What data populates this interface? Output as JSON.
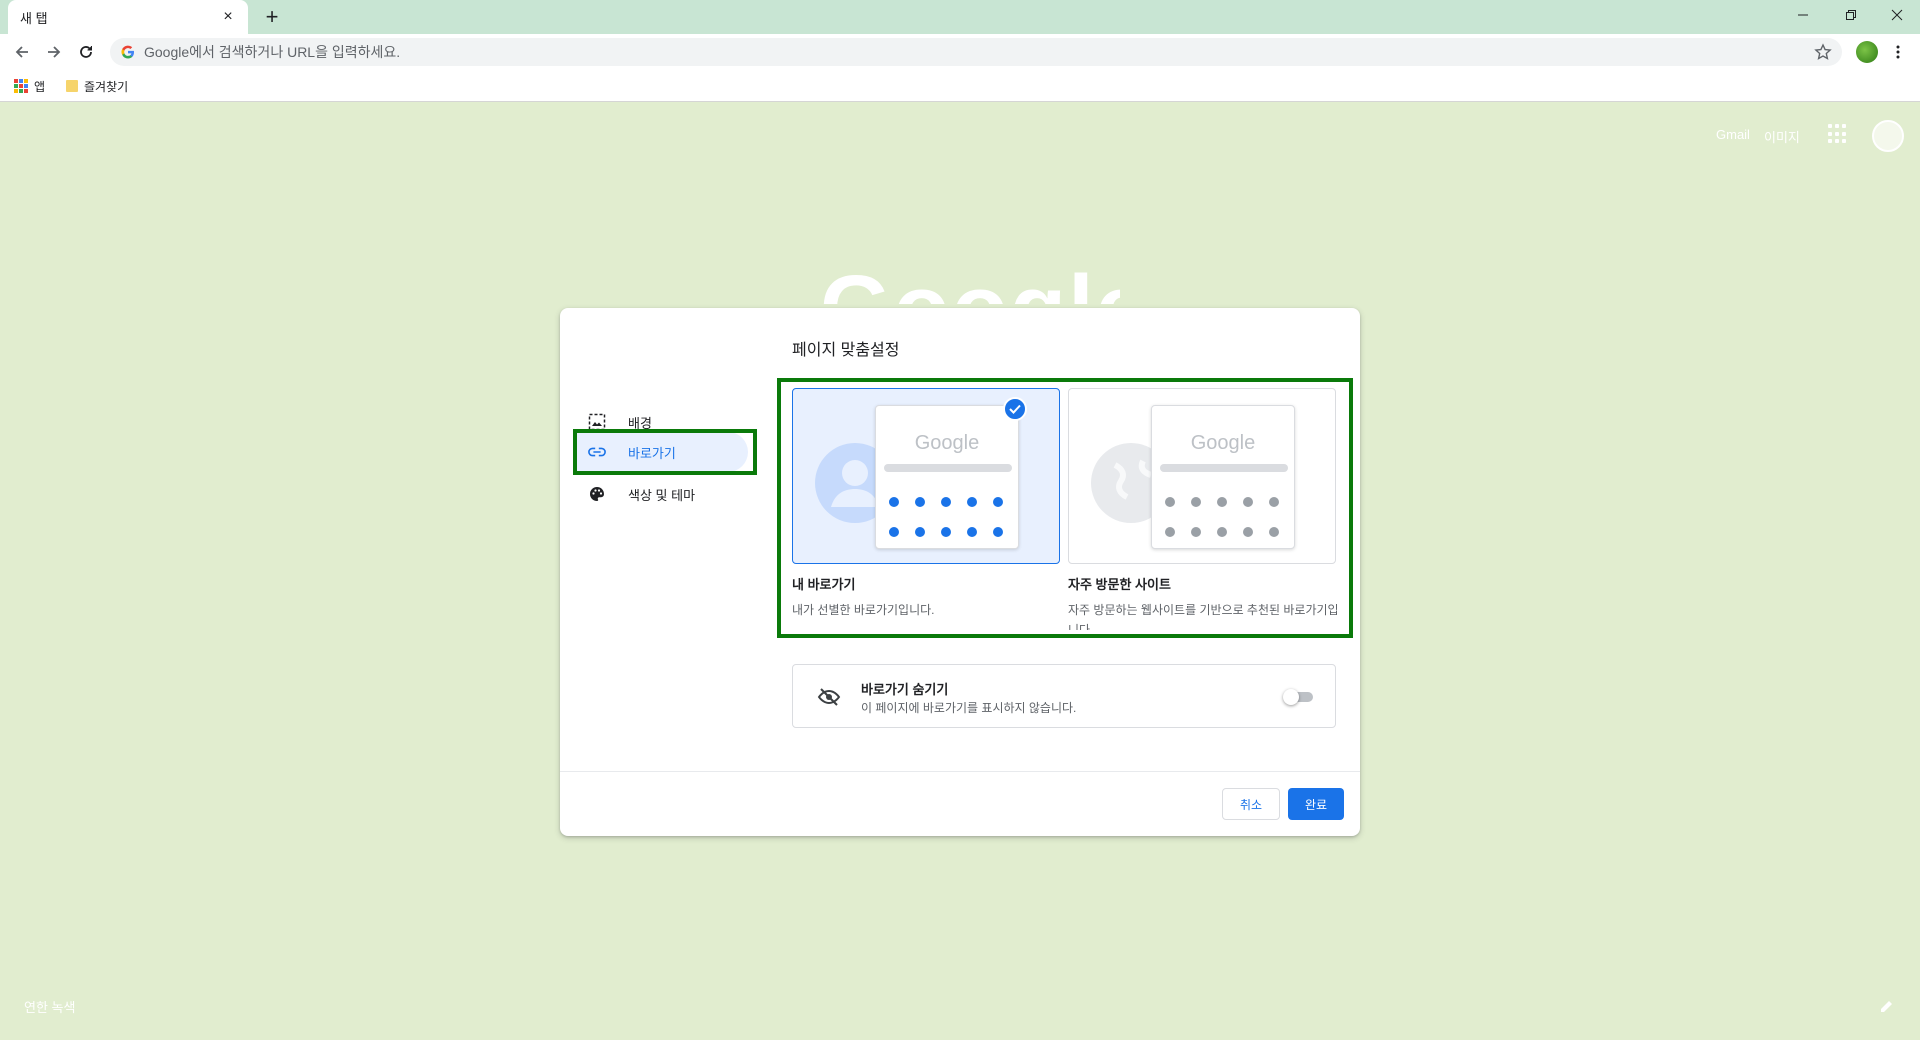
{
  "tab": {
    "title": "새 탭"
  },
  "omnibox": {
    "placeholder": "Google에서 검색하거나 URL을 입력하세요."
  },
  "bookmarks": {
    "apps_label": "앱",
    "folder_label": "즐겨찾기"
  },
  "ntp": {
    "gmail_label": "Gmail",
    "images_label": "이미지",
    "logo_text": "Google",
    "attribution": "연한 녹색"
  },
  "dialog": {
    "title": "페이지 맞춤설정",
    "menu": [
      {
        "label": "배경",
        "icon": "background-icon"
      },
      {
        "label": "바로가기",
        "icon": "link-icon",
        "selected": true
      },
      {
        "label": "색상 및 테마",
        "icon": "palette-icon"
      }
    ],
    "options": [
      {
        "preview_logo": "Google",
        "label": "내 바로가기",
        "desc": "내가 선별한 바로가기입니다.",
        "selected": true
      },
      {
        "preview_logo": "Google",
        "label": "자주 방문한 사이트",
        "desc": "자주 방문하는 웹사이트를 기반으로 추천된 바로가기입니다.",
        "selected": false
      }
    ],
    "hide": {
      "title": "바로가기 숨기기",
      "desc": "이 페이지에 바로가기를 표시하지 않습니다.",
      "enabled": false
    },
    "cancel_label": "취소",
    "done_label": "완료"
  },
  "colors": {
    "ntp_background": "#e1edcf",
    "tabstrip": "#c8e5d3",
    "accent": "#1a73e8",
    "highlight_box": "#0a7a0a"
  }
}
